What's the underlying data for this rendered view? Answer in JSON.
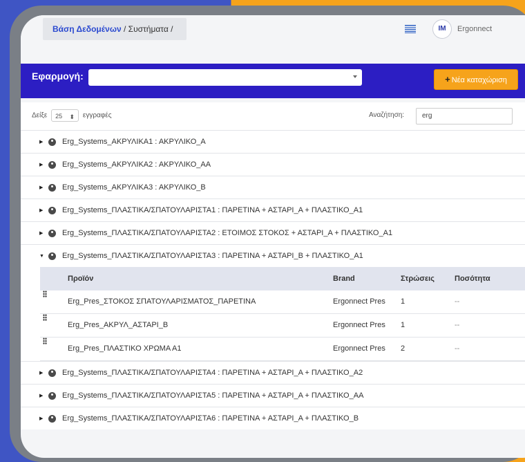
{
  "breadcrumb": {
    "database": "Βάση Δεδομένων",
    "separator1": " / ",
    "systems": "Συστήματα",
    "separator2": " /"
  },
  "user": {
    "initials": "IM",
    "name": "Ergonnect"
  },
  "application": {
    "label": "Εφαρμογή:",
    "value": ""
  },
  "new_entry_button": {
    "label": "Νέα καταχώριση"
  },
  "length": {
    "prefix": "Δείξε",
    "value": "25",
    "suffix": "εγγραφές"
  },
  "search": {
    "label": "Αναζήτηση:",
    "value": "erg"
  },
  "rows_before": [
    {
      "toggle": "▶",
      "text": "Erg_Systems_ΑΚΡΥΛΙΚΑ1 :  ΑΚΡΥΛΙΚΟ_Α"
    },
    {
      "toggle": "▶",
      "text": "Erg_Systems_ΑΚΡΥΛΙΚΑ2 :  ΑΚΡΥΛΙΚΟ_ΑΑ"
    },
    {
      "toggle": "▶",
      "text": "Erg_Systems_ΑΚΡΥΛΙΚΑ3 :  ΑΚΡΥΛΙΚΟ_Β"
    },
    {
      "toggle": "▶",
      "text": "Erg_Systems_ΠΛΑΣΤΙΚΑ/ΣΠΑΤΟΥΛΑΡΙΣΤΑ1 :  ΠΑΡΕΤΙΝΑ + ΑΣΤΑΡΙ_Α + ΠΛΑΣΤΙΚΟ_Α1"
    },
    {
      "toggle": "▶",
      "text": "Erg_Systems_ΠΛΑΣΤΙΚΑ/ΣΠΑΤΟΥΛΑΡΙΣΤΑ2 :  ΕΤΟΙΜΟΣ ΣΤΟΚΟΣ + ΑΣΤΑΡΙ_Α + ΠΛΑΣΤΙΚΟ_Α1"
    },
    {
      "toggle": "▼",
      "text": "Erg_Systems_ΠΛΑΣΤΙΚΑ/ΣΠΑΤΟΥΛΑΡΙΣΤΑ3 :  ΠΑΡΕΤΙΝΑ + ΑΣΤΑΡΙ_Β + ΠΛΑΣΤΙΚΟ_Α1"
    }
  ],
  "subtable": {
    "headers": {
      "product": "Προϊόν",
      "brand": "Brand",
      "layers": "Στρώσεις",
      "quantity": "Ποσότητα"
    },
    "rows": [
      {
        "product": "Erg_Pres_ΣΤΟΚΟΣ ΣΠΑΤΟΥΛΑΡΙΣΜΑΤΟΣ_ΠΑΡΕΤΙΝΑ",
        "brand": "Ergonnect Pres",
        "layers": "1",
        "quantity": "--"
      },
      {
        "product": "Erg_Pres_ΑΚΡΥΛ_ΑΣΤΑΡΙ_Β",
        "brand": "Ergonnect Pres",
        "layers": "1",
        "quantity": "--"
      },
      {
        "product": "Erg_Pres_ΠΛΑΣΤΙΚΟ ΧΡΩΜΑ Α1",
        "brand": "Ergonnect Pres",
        "layers": "2",
        "quantity": "--"
      }
    ]
  },
  "rows_after": [
    {
      "toggle": "▶",
      "text": "Erg_Systems_ΠΛΑΣΤΙΚΑ/ΣΠΑΤΟΥΛΑΡΙΣΤΑ4 :  ΠΑΡΕΤΙΝΑ + ΑΣΤΑΡΙ_Α + ΠΛΑΣΤΙΚΟ_Α2"
    },
    {
      "toggle": "▶",
      "text": "Erg_Systems_ΠΛΑΣΤΙΚΑ/ΣΠΑΤΟΥΛΑΡΙΣΤΑ5 :  ΠΑΡΕΤΙΝΑ + ΑΣΤΑΡΙ_Α + ΠΛΑΣΤΙΚΟ_ΑΑ"
    },
    {
      "toggle": "▶",
      "text": "Erg_Systems_ΠΛΑΣΤΙΚΑ/ΣΠΑΤΟΥΛΑΡΙΣΤΑ6 :  ΠΑΡΕΤΙΝΑ + ΑΣΤΑΡΙ_Α + ΠΛΑΣΤΙΚΟ_Β"
    }
  ],
  "colors": {
    "ribbon": "#2c1ec3",
    "accent": "#f6a31b",
    "link": "#2b4ad0",
    "left_bg": "#3f55c4",
    "right_bg": "#f6a31b"
  }
}
